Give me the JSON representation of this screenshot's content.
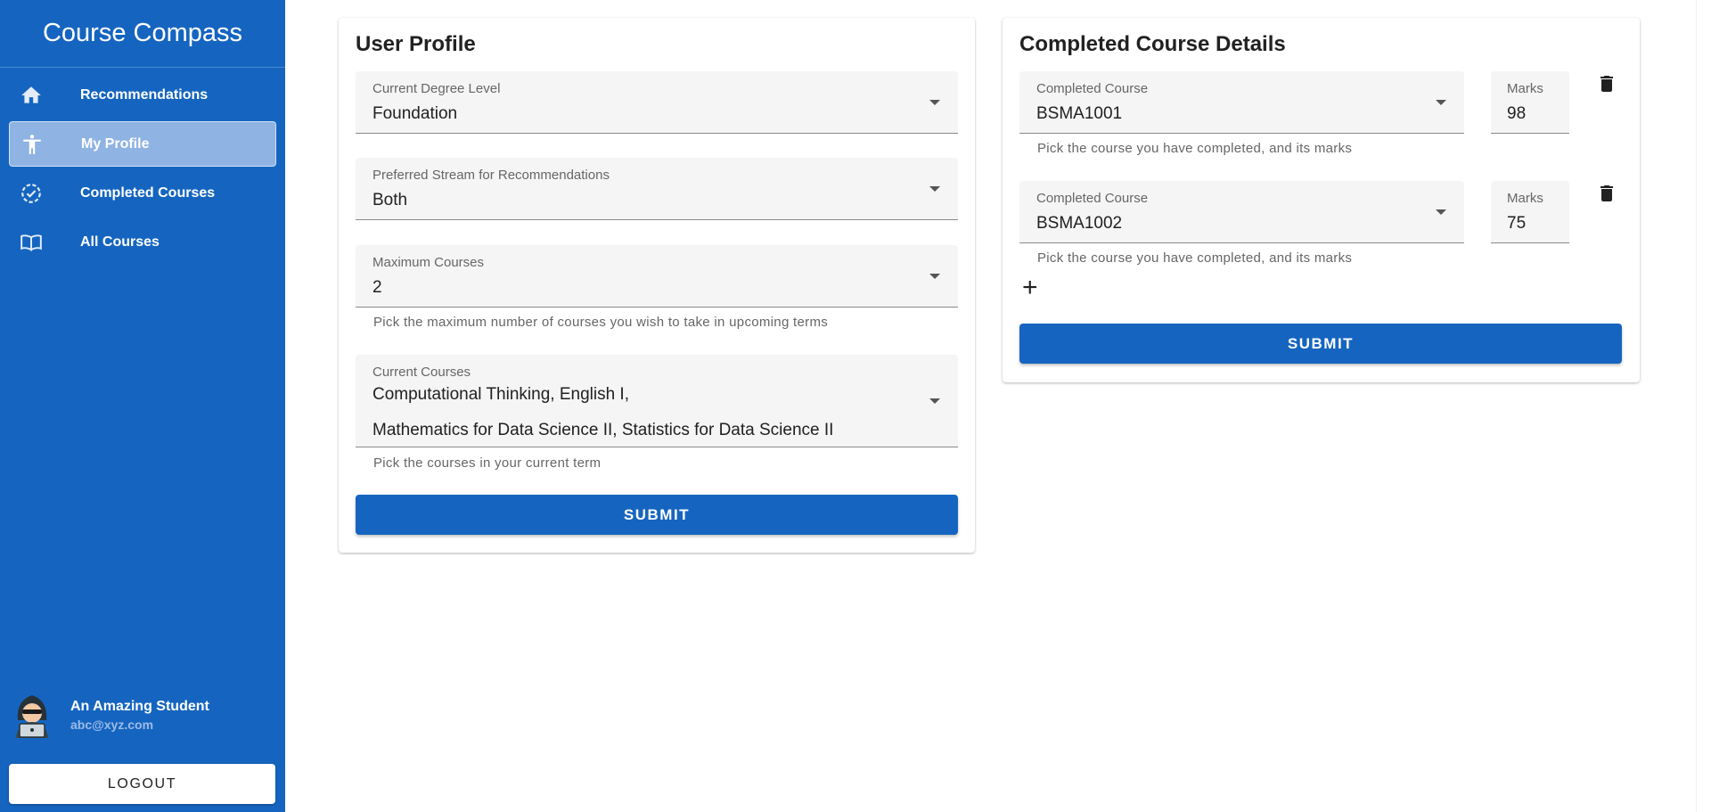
{
  "sidebar": {
    "brand": "Course Compass",
    "items": [
      {
        "label": "Recommendations",
        "icon": "home-icon"
      },
      {
        "label": "My Profile",
        "icon": "accessibility-icon"
      },
      {
        "label": "Completed Courses",
        "icon": "task-alt-icon"
      },
      {
        "label": "All Courses",
        "icon": "menu-book-icon"
      }
    ],
    "active_item": "My Profile",
    "user": {
      "name": "An Amazing Student",
      "email": "abc@xyz.com"
    },
    "logout_label": "LOGOUT"
  },
  "profile": {
    "title": "User Profile",
    "degree": {
      "label": "Current Degree Level",
      "value": "Foundation"
    },
    "stream": {
      "label": "Preferred Stream for Recommendations",
      "value": "Both"
    },
    "max_courses": {
      "label": "Maximum Courses",
      "value": "2",
      "helper": "Pick the maximum number of courses you wish to take in upcoming terms"
    },
    "current_courses": {
      "label": "Current Courses",
      "line1": "Computational Thinking, English I,",
      "line2": "Mathematics for Data Science II, Statistics for Data Science II",
      "helper": "Pick the courses in your current term"
    },
    "submit_label": "SUBMIT"
  },
  "completed": {
    "title": "Completed Course Details",
    "rows": [
      {
        "course_label": "Completed Course",
        "course": "BSMA1001",
        "marks_label": "Marks",
        "marks": "98",
        "helper": "Pick the course you have completed, and its marks"
      },
      {
        "course_label": "Completed Course",
        "course": "BSMA1002",
        "marks_label": "Marks",
        "marks": "75",
        "helper": "Pick the course you have completed, and its marks"
      }
    ],
    "add_symbol": "+",
    "submit_label": "SUBMIT"
  },
  "colors": {
    "primary": "#1565c0",
    "active_nav": "#8fb3e3",
    "field_bg": "#f5f5f5"
  }
}
